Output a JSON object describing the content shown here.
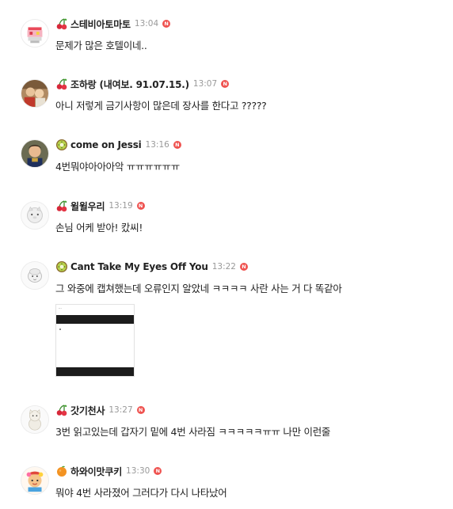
{
  "comments": [
    {
      "nickname": "스테비아토마토",
      "time": "13:04",
      "text": "문제가 많은 호텔이네..",
      "level_icon": "cherry-icon",
      "new_badge": "N"
    },
    {
      "nickname": "조하랑 (내여보. 91.07.15.)",
      "time": "13:07",
      "text": "아니 저렇게 금기사항이 많은데 장사를 한다고 ?????",
      "level_icon": "cherry-icon",
      "new_badge": "N"
    },
    {
      "nickname": "come on Jessi",
      "time": "13:16",
      "text": "4번뭐야아아아악 ㅠㅠㅠㅠㅠㅠ",
      "level_icon": "kiwi-icon",
      "new_badge": "N"
    },
    {
      "nickname": "윌윌우리",
      "time": "13:19",
      "text": "손님 어케 받아! 캈씨!",
      "level_icon": "cherry-icon",
      "new_badge": "N"
    },
    {
      "nickname": "Cant Take My Eyes Off You",
      "time": "13:22",
      "text": "그 와중에 캡쳐했는데 오류인지 알았네 ㅋㅋㅋㅋ 사란 사는 거 다 똑같아",
      "level_icon": "kiwi-icon",
      "new_badge": "N",
      "attachment": "image-attachment"
    },
    {
      "nickname": "갓기천사",
      "time": "13:27",
      "text": "3번 읽고있는데 갑자기 밑에 4번 사라짐 ㅋㅋㅋㅋㅋㅠㅠ 나만 이런줄",
      "level_icon": "cherry-icon",
      "new_badge": "N"
    },
    {
      "nickname": "하와이맛쿠키",
      "time": "13:30",
      "text": "뭐야 4번 사라졌어 그러다가 다시 나타났어",
      "level_icon": "orange-icon",
      "new_badge": "N"
    }
  ],
  "colors": {
    "new_badge": "#ef5350",
    "time": "#999999",
    "nickname": "#222222"
  }
}
